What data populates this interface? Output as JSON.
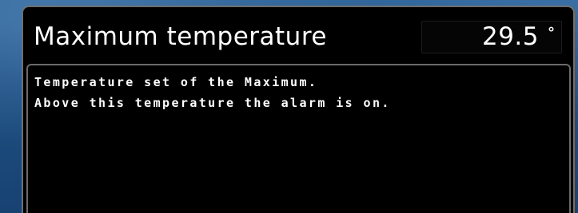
{
  "setting": {
    "title": "Maximum temperature",
    "value": "29.5",
    "unit": "°"
  },
  "description": {
    "lines": [
      "Temperature set of the Maximum.",
      "Above this temperature the alarm is on."
    ]
  },
  "colors": {
    "background": "#1f4f82",
    "screen": "#000000",
    "text": "#ffffff",
    "frame_border": "#6f6f6f"
  }
}
